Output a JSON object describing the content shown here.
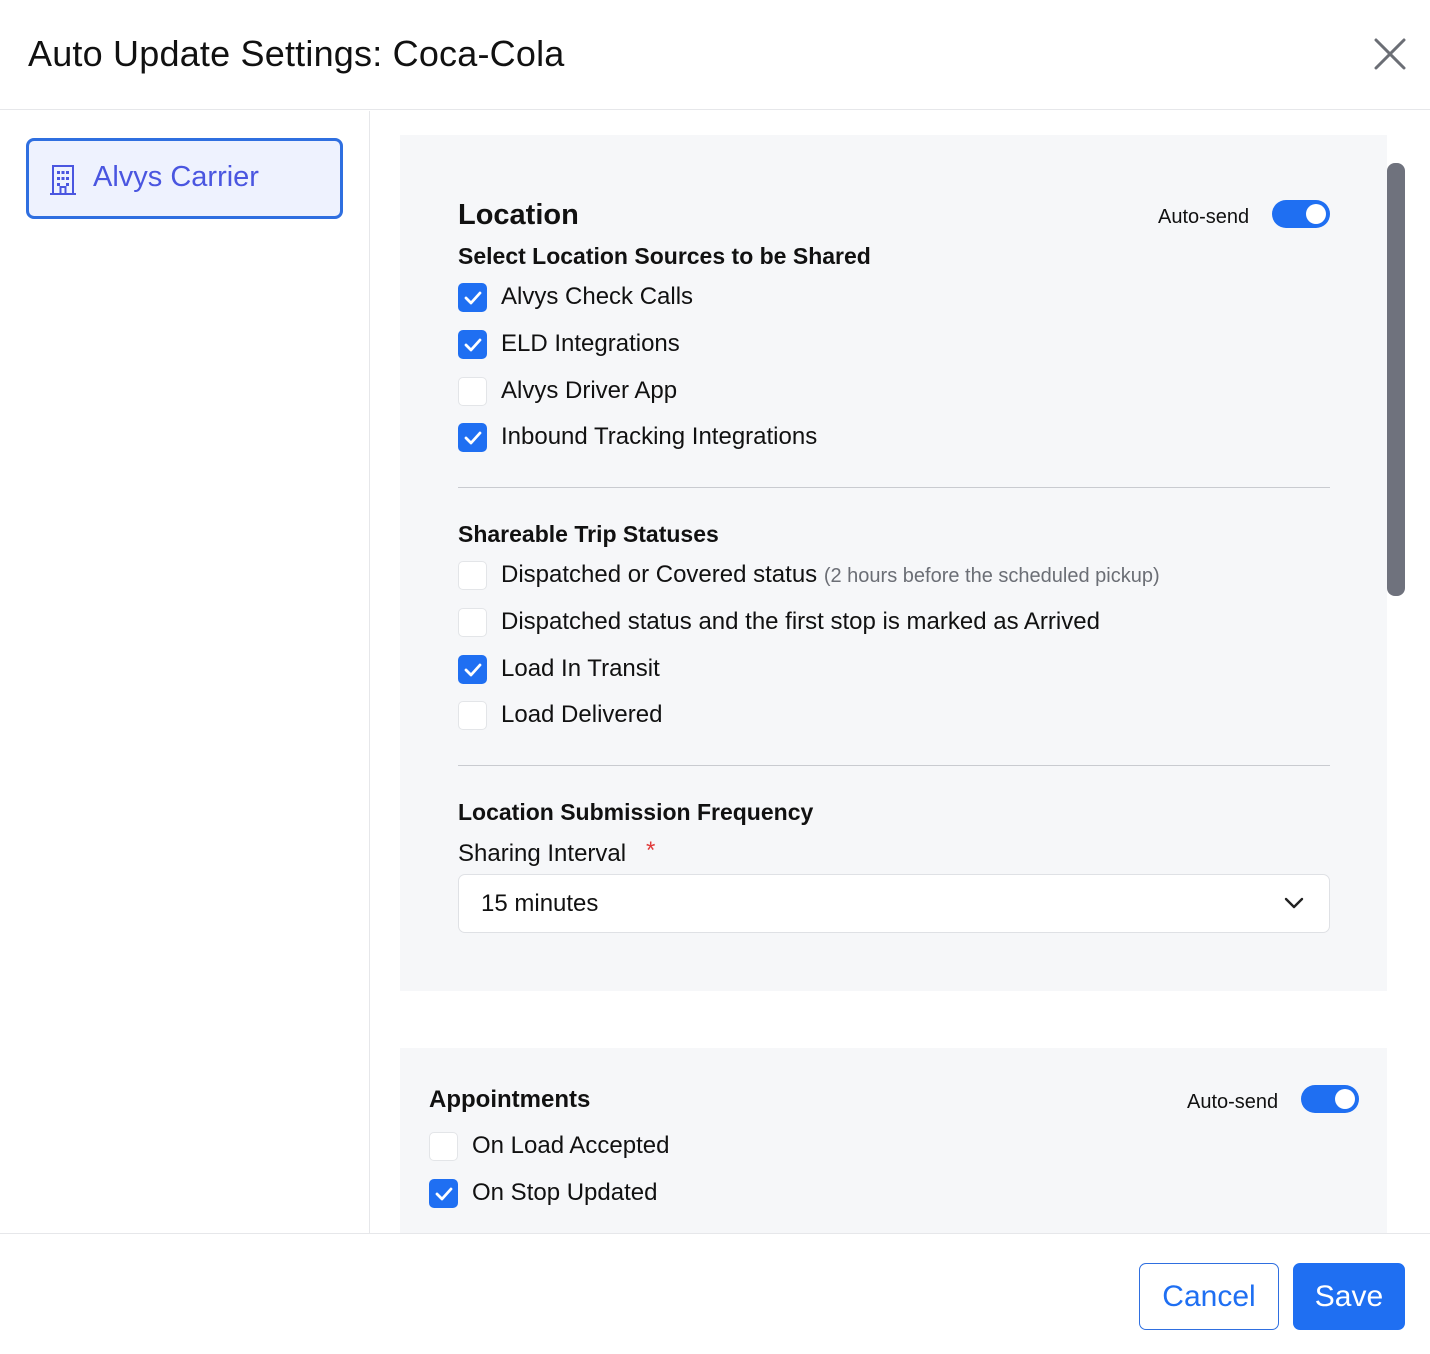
{
  "dialog": {
    "title": "Auto Update Settings: Coca-Cola",
    "close_icon": "close-icon"
  },
  "sidebar": {
    "items": [
      {
        "label": "Alvys Carrier",
        "icon": "building-icon",
        "selected": true
      }
    ]
  },
  "location": {
    "title": "Location",
    "autosend_label": "Auto-send",
    "autosend_on": true,
    "sources_title": "Select Location Sources to be Shared",
    "sources": [
      {
        "label": "Alvys Check Calls",
        "checked": true
      },
      {
        "label": "ELD Integrations",
        "checked": true
      },
      {
        "label": "Alvys Driver App",
        "checked": false
      },
      {
        "label": "Inbound Tracking Integrations",
        "checked": true
      }
    ],
    "statuses_title": "Shareable Trip Statuses",
    "statuses": [
      {
        "label": "Dispatched or Covered status",
        "note": "(2 hours before the scheduled pickup)",
        "checked": false
      },
      {
        "label": "Dispatched status and the first stop is marked as Arrived",
        "note": "",
        "checked": false
      },
      {
        "label": "Load In Transit",
        "note": "",
        "checked": true
      },
      {
        "label": "Load Delivered",
        "note": "",
        "checked": false
      }
    ],
    "frequency_title": "Location Submission Frequency",
    "interval_label": "Sharing Interval",
    "required_mark": "*",
    "interval_value": "15 minutes"
  },
  "appointments": {
    "title": "Appointments",
    "autosend_label": "Auto-send",
    "autosend_on": true,
    "options": [
      {
        "label": "On Load Accepted",
        "checked": false
      },
      {
        "label": "On Stop Updated",
        "checked": true
      }
    ]
  },
  "footer": {
    "cancel_label": "Cancel",
    "save_label": "Save"
  },
  "colors": {
    "accent": "#1f6ff2",
    "sidebar_selected_bg": "#eef2fe",
    "sidebar_selected_text": "#4a56e0",
    "section_bg": "#f6f7f9",
    "required": "#e03a3a"
  }
}
